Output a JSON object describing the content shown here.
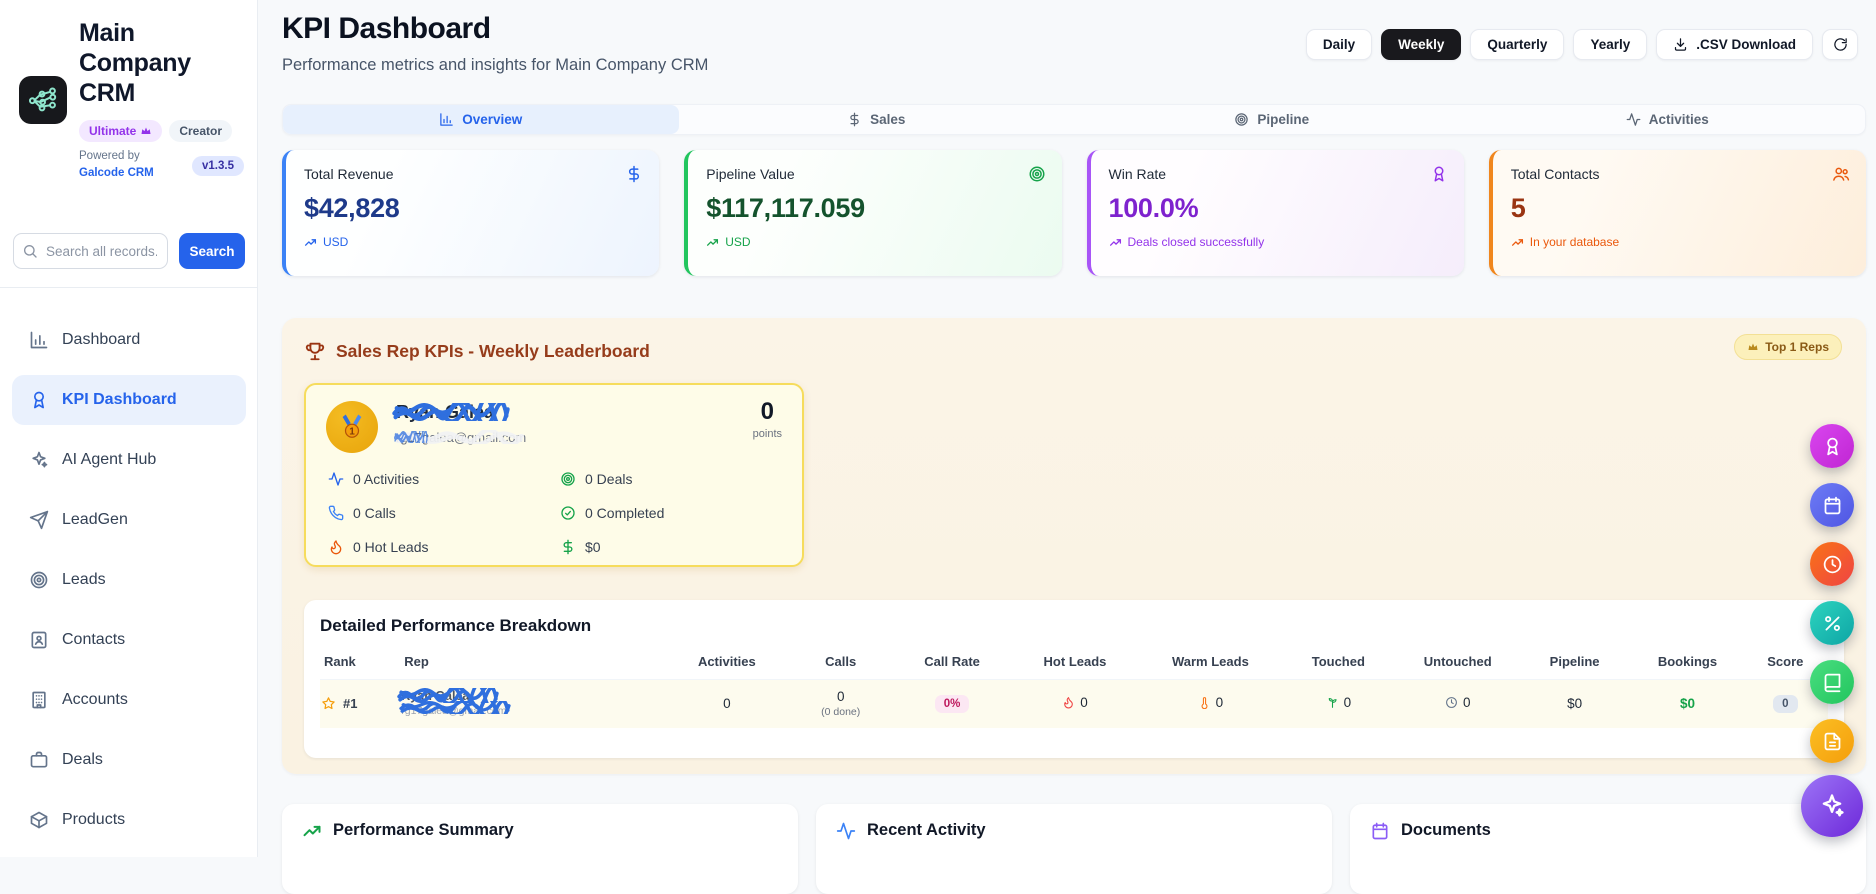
{
  "sidebar": {
    "company_name": "Main Company CRM",
    "plan_badge": "Ultimate",
    "role_badge": "Creator",
    "version_badge": "v1.3.5",
    "powered_by_label": "Powered by",
    "powered_by_link": "Galcode CRM",
    "search": {
      "placeholder": "Search all records...",
      "button_label": "Search"
    },
    "nav": [
      {
        "label": "Dashboard",
        "icon": "bar-chart",
        "active": false
      },
      {
        "label": "KPI Dashboard",
        "icon": "award",
        "active": true
      },
      {
        "label": "AI Agent Hub",
        "icon": "sparkles",
        "active": false
      },
      {
        "label": "LeadGen",
        "icon": "send",
        "active": false
      },
      {
        "label": "Leads",
        "icon": "target",
        "active": false
      },
      {
        "label": "Contacts",
        "icon": "contact-card",
        "active": false
      },
      {
        "label": "Accounts",
        "icon": "building",
        "active": false
      },
      {
        "label": "Deals",
        "icon": "briefcase",
        "active": false
      },
      {
        "label": "Products",
        "icon": "package",
        "active": false
      }
    ]
  },
  "header": {
    "title": "KPI Dashboard",
    "subtitle": "Performance metrics and insights for Main Company CRM",
    "periods": {
      "daily": "Daily",
      "weekly": "Weekly",
      "quarterly": "Quarterly",
      "yearly": "Yearly"
    },
    "active_period": "Weekly",
    "csv_label": ".CSV Download"
  },
  "tabs": {
    "overview": "Overview",
    "sales": "Sales",
    "pipeline": "Pipeline",
    "activities": "Activities",
    "active": "Overview"
  },
  "kpi_cards": [
    {
      "title": "Total Revenue",
      "value": "$42,828",
      "footer": "USD",
      "accent": "#3b82f6"
    },
    {
      "title": "Pipeline Value",
      "value": "$117,117.059",
      "footer": "USD",
      "accent": "#22c55e"
    },
    {
      "title": "Win Rate",
      "value": "100.0%",
      "footer": "Deals closed successfully",
      "accent": "#a855f7"
    },
    {
      "title": "Total Contacts",
      "value": "5",
      "footer": "In your database",
      "accent": "#f97316"
    }
  ],
  "leaderboard": {
    "title": "Sales Rep KPIs - Weekly Leaderboard",
    "top_reps_badge": "Top 1 Reps",
    "rep_card": {
      "name": "Ryan Galea",
      "email": "rg17galea@gmail.com",
      "points_value": "0",
      "points_label": "points",
      "stats": {
        "activities": "0 Activities",
        "deals": "0 Deals",
        "calls": "0 Calls",
        "completed": "0 Completed",
        "hot_leads": "0 Hot Leads",
        "revenue": "$0"
      }
    }
  },
  "breakdown": {
    "title": "Detailed Performance Breakdown",
    "columns": [
      "Rank",
      "Rep",
      "Activities",
      "Calls",
      "Call Rate",
      "Hot Leads",
      "Warm Leads",
      "Touched",
      "Untouched",
      "Pipeline",
      "Bookings",
      "Score"
    ],
    "row": {
      "rank": "#1",
      "rep_name": "Ryan Galea",
      "rep_email": "rg17galea@gmail.com",
      "activities": "0",
      "calls": "0",
      "calls_done": "(0 done)",
      "call_rate": "0%",
      "hot_leads": "0",
      "warm_leads": "0",
      "touched": "0",
      "untouched": "0",
      "pipeline": "$0",
      "bookings": "$0",
      "score": "0"
    }
  },
  "bottom_sections": {
    "performance_summary": "Performance Summary",
    "recent_activity": "Recent Activity",
    "documents": "Documents"
  },
  "fab_icons": [
    "award",
    "calendar",
    "clock",
    "percent",
    "book",
    "file-text",
    "sparkles"
  ],
  "colors": {
    "primary_blue": "#2563eb",
    "active_button_dark": "#19191d",
    "leaderboard_panel": "#faf3e4",
    "rep_card_yellow": "#fefce8",
    "rate_pill_pink": "#fce7f3"
  }
}
